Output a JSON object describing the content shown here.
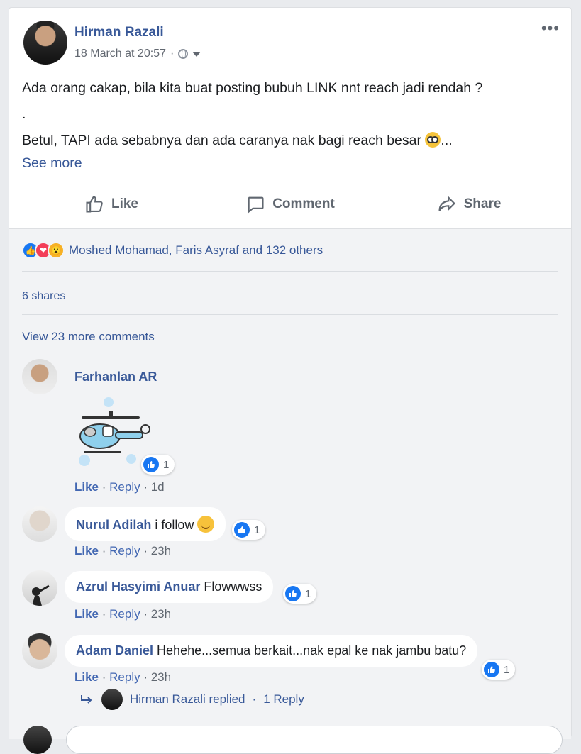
{
  "post": {
    "author": "Hirman Razali",
    "timestamp": "18 March at 20:57",
    "separator": "·",
    "more_menu": "•••",
    "text_line1": "Ada orang cakap, bila kita buat posting bubuh LINK nnt reach jadi rendah ?",
    "text_line2": ".",
    "text_line3": "Betul, TAPI ada sebabnya dan ada caranya nak bagi reach besar",
    "ellipsis": "...",
    "see_more": "See more"
  },
  "actions": {
    "like": "Like",
    "comment": "Comment",
    "share": "Share"
  },
  "reactions": {
    "summary": "Moshed Mohamad, Faris Asyraf and 132 others",
    "shares": "6 shares",
    "view_more": "View 23 more comments"
  },
  "comments": [
    {
      "name": "Farhanlan AR",
      "text": "",
      "like": "Like",
      "reply": "Reply",
      "time": "1d",
      "reaction_count": "1",
      "sticker": "helicopter-sticker"
    },
    {
      "name": "Nurul Adilah",
      "text": "i follow",
      "like": "Like",
      "reply": "Reply",
      "time": "23h",
      "reaction_count": "1"
    },
    {
      "name": "Azrul Hasyimi Anuar",
      "text": "Flowwwss",
      "like": "Like",
      "reply": "Reply",
      "time": "23h",
      "reaction_count": "1"
    },
    {
      "name": "Adam Daniel",
      "text": "Hehehe...semua berkait...nak epal ke nak jambu batu?",
      "like": "Like",
      "reply": "Reply",
      "time": "23h",
      "reaction_count": "1"
    }
  ],
  "replied": {
    "text": "Hirman Razali replied",
    "separator": "·",
    "count": "1 Reply"
  },
  "colors": {
    "link": "#385898",
    "like_blue": "#1877f2",
    "background": "#f2f3f5"
  }
}
